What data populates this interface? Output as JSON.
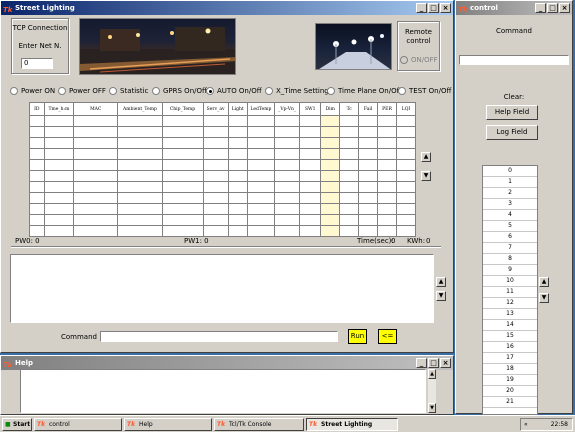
{
  "main": {
    "title": "Street Lighting",
    "tcp_label": "TCP Connection",
    "enter_net_label": "Enter Net N.",
    "net_value": "0",
    "remote_label": "Remote control",
    "onoff_label": "ON/OFF",
    "radios": [
      "Power ON",
      "Power OFF",
      "Statistic",
      "GPRS On/Off",
      "AUTO On/Off",
      "X_Time Setting",
      "Time Plane On/Off",
      "TEST On/Off"
    ],
    "columns": [
      "ID",
      "Tme_h:m",
      "MAC",
      "Ambient_Temp",
      "Chip_Temp",
      "Serv_av",
      "Light",
      "LedTemp",
      "_Vp-Vn_",
      "SW1",
      "Dim",
      "Tc",
      "Fail",
      "PER",
      "LQI"
    ],
    "pw0": "PW0: 0",
    "pw1": "PW1: 0",
    "time_label": "Time(sec):",
    "time_value": "0",
    "kwh_label": "KWh:",
    "kwh_value": "0",
    "command_label": "Command",
    "run_label": "Run",
    "back_label": "<="
  },
  "control": {
    "title": "control",
    "command_label": "Command",
    "clear_label": "Clear:",
    "help_field_btn": "Help Field",
    "log_field_btn": "Log Field",
    "numbers": [
      "0",
      "1",
      "2",
      "3",
      "4",
      "5",
      "6",
      "7",
      "8",
      "9",
      "10",
      "11",
      "12",
      "13",
      "14",
      "15",
      "16",
      "17",
      "18",
      "19",
      "20",
      "21"
    ]
  },
  "help": {
    "title": "Help"
  },
  "taskbar": {
    "start": "Start",
    "tasks": [
      "control",
      "Help",
      "Tcl/Tk Console",
      "Street Lighting"
    ],
    "clock": "22:58",
    "tray": "«"
  },
  "colors": {
    "titlebar": "#0a246a",
    "desktop": "#3a6ea5",
    "button_yellow": "#ffff00"
  },
  "icons": {
    "window_icon": "tk-icon",
    "minimize": "minimize-icon",
    "maximize": "maximize-icon",
    "close": "close-icon"
  }
}
